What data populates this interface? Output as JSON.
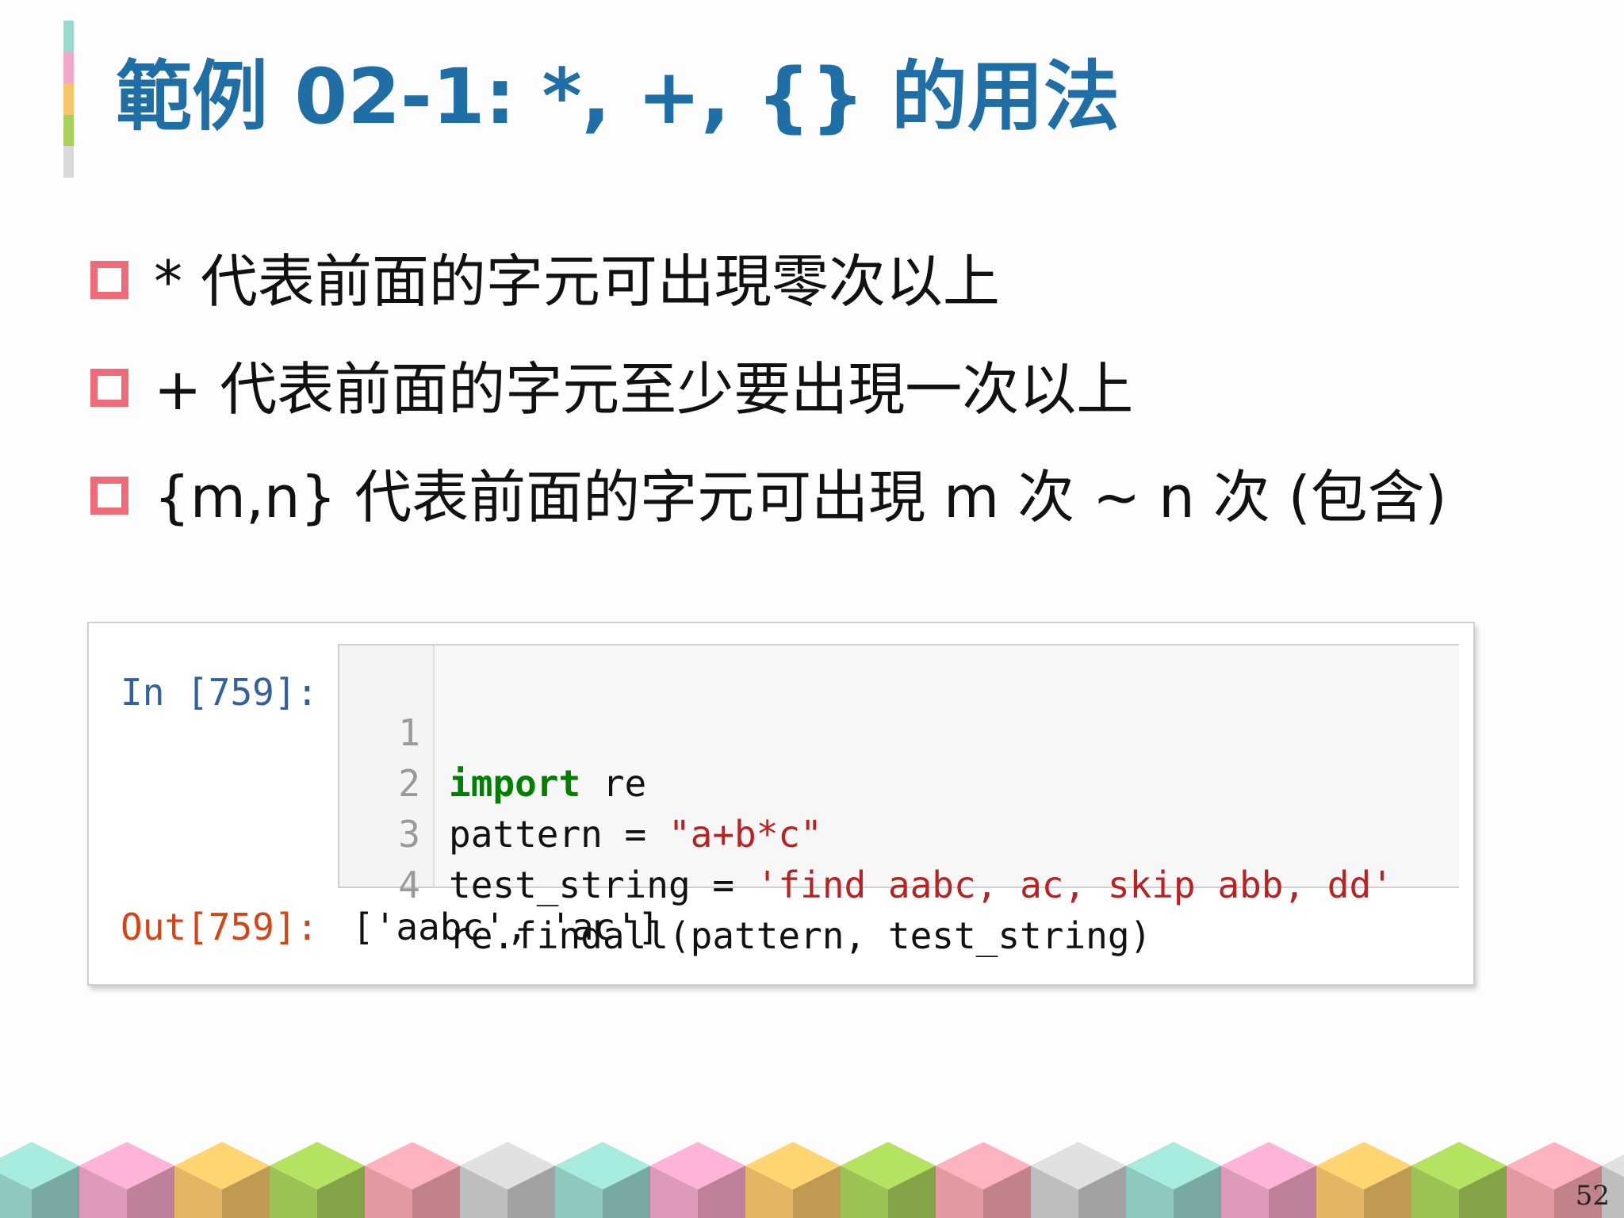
{
  "slide": {
    "title": "範例 02-1: *, +, {} 的用法",
    "accent_colors": [
      "#9ad9cf",
      "#f2a6c8",
      "#f6c56a",
      "#a8d15a",
      "#d9d9d9"
    ],
    "bullet_color": "#f06b78",
    "bullets": [
      "* 代表前面的字元可出現零次以上",
      "+ 代表前面的字元至少要出現一次以上",
      "{m,n} 代表前面的字元可出現 m 次 ~ n 次 (包含)"
    ],
    "page_number": "52"
  },
  "notebook_cell": {
    "in_prompt": "In [759]:",
    "lines": [
      {
        "num": "1",
        "kw": "import",
        "rest": " re",
        "pre": "",
        "str": "",
        "post": ""
      },
      {
        "num": "2",
        "kw": "",
        "rest": "",
        "pre": "pattern = ",
        "str": "\"a+b*c\"",
        "post": ""
      },
      {
        "num": "3",
        "kw": "",
        "rest": "",
        "pre": "test_string = ",
        "str": "'find aabc, ac, skip abb, dd'",
        "post": ""
      },
      {
        "num": "4",
        "kw": "",
        "rest": "",
        "pre": "re.findall(pattern, test_string)",
        "str": "",
        "post": ""
      }
    ],
    "out_prompt": "Out[759]:",
    "output": "['aabc', 'ac']"
  },
  "footer": {
    "cube_colors": [
      "#9ad9cf",
      "#f2a6c8",
      "#f6c56a",
      "#a8d15a",
      "#f6a6b0",
      "#cfcfcf"
    ]
  }
}
